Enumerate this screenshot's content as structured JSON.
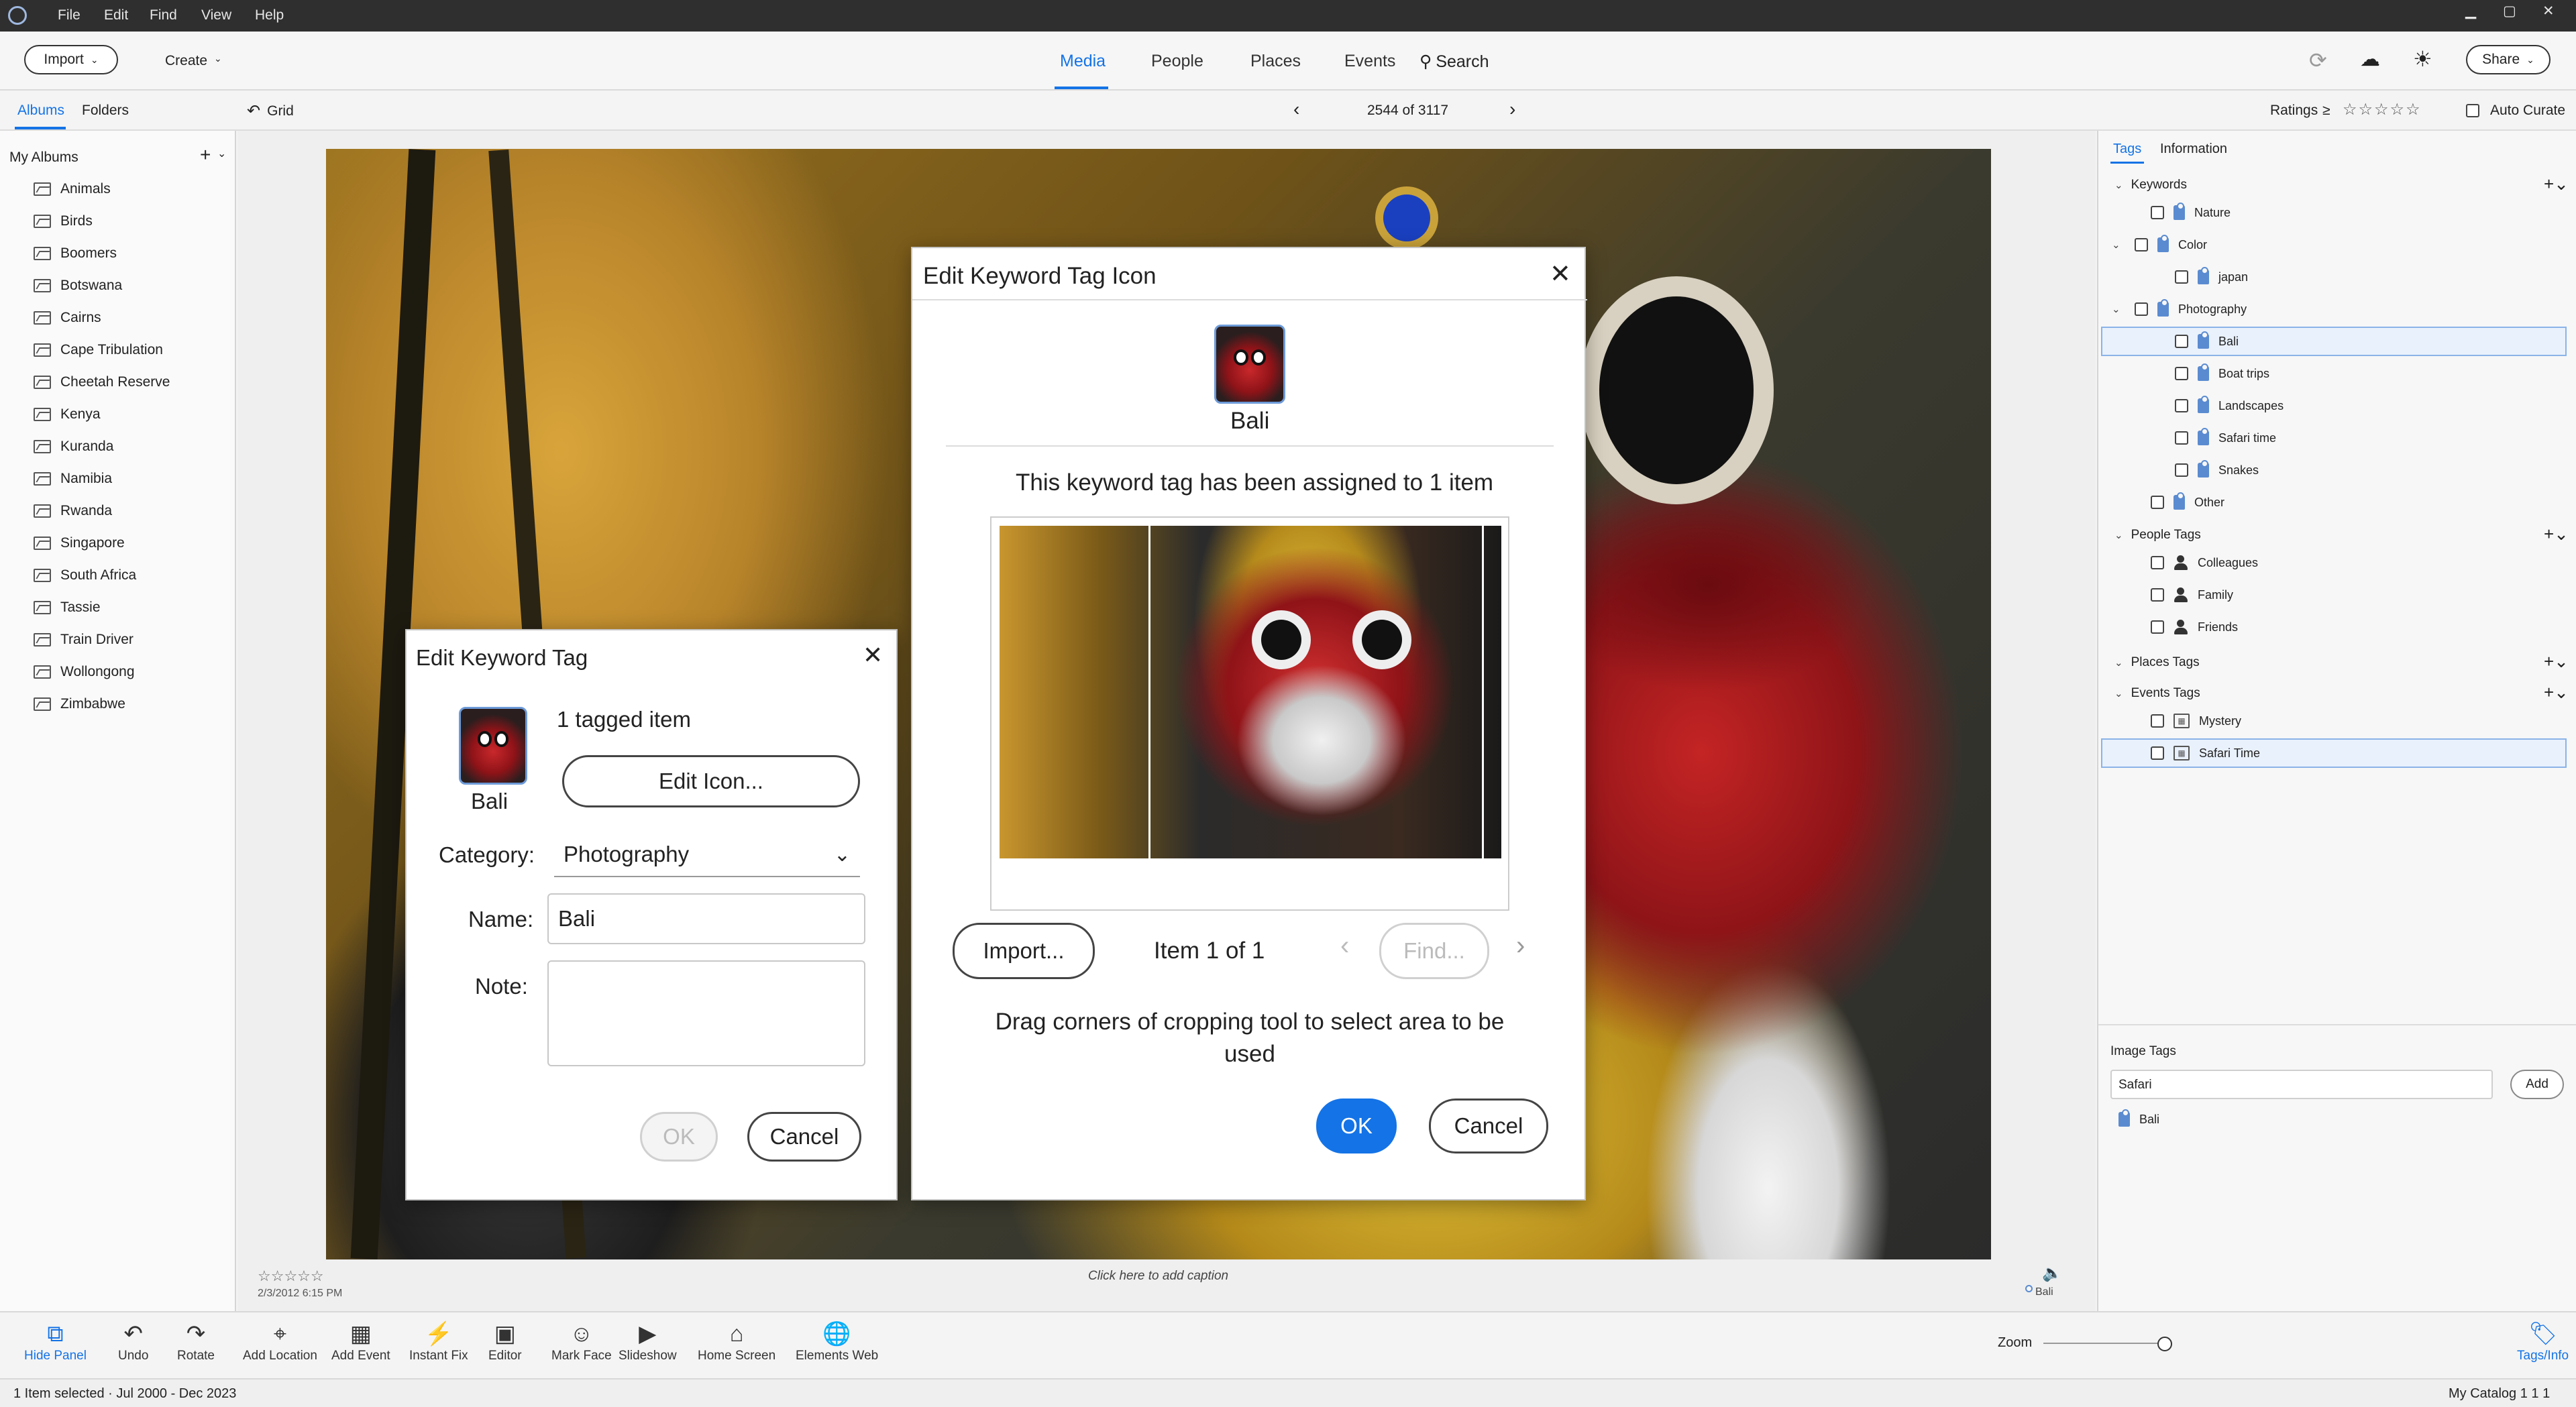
{
  "menu": {
    "items": [
      "File",
      "Edit",
      "Find",
      "View",
      "Help"
    ]
  },
  "header": {
    "import_label": "Import",
    "create_label": "Create",
    "tabs": [
      "Media",
      "People",
      "Places",
      "Events"
    ],
    "search_label": "Search",
    "share_label": "Share"
  },
  "subbar": {
    "albums_tab": "Albums",
    "folders_tab": "Folders",
    "grid_label": "Grid",
    "counter": "2544 of 3117",
    "ratings_label": "Ratings",
    "ratings_op": "≥",
    "auto_curate_label": "Auto Curate"
  },
  "albums": {
    "title": "My Albums",
    "items": [
      "Animals",
      "Birds",
      "Boomers",
      "Botswana",
      "Cairns",
      "Cape Tribulation",
      "Cheetah Reserve",
      "Kenya",
      "Kuranda",
      "Namibia",
      "Rwanda",
      "Singapore",
      "South Africa",
      "Tassie",
      "Train Driver",
      "Wollongong",
      "Zimbabwe"
    ]
  },
  "photo": {
    "stars": "☆☆☆☆☆",
    "date": "2/3/2012 6:15 PM",
    "caption_hint": "Click here to add caption",
    "tag_label": "Bali"
  },
  "right": {
    "tabs": [
      "Tags",
      "Information"
    ],
    "keywords_title": "Keywords",
    "keywords": [
      {
        "label": "Nature"
      },
      {
        "label": "Color"
      },
      {
        "label": "japan"
      },
      {
        "label": "Photography"
      },
      {
        "label": "Bali"
      },
      {
        "label": "Boat trips"
      },
      {
        "label": "Landscapes"
      },
      {
        "label": "Safari time"
      },
      {
        "label": "Snakes"
      },
      {
        "label": "Other"
      }
    ],
    "people_title": "People Tags",
    "people": [
      "Colleagues",
      "Family",
      "Friends"
    ],
    "places_title": "Places Tags",
    "events_title": "Events Tags",
    "events": [
      "Mystery",
      "Safari Time"
    ],
    "image_tags_title": "Image Tags",
    "image_tags_input": "Safari",
    "add_label": "Add",
    "image_tag_item": "Bali"
  },
  "toolbar": {
    "tools": [
      "Hide Panel",
      "Undo",
      "Rotate",
      "Add Location",
      "Add Event",
      "Instant Fix",
      "Editor",
      "Mark Face",
      "Slideshow",
      "Home Screen",
      "Elements Web"
    ],
    "zoom_label": "Zoom",
    "tags_info_label": "Tags/Info"
  },
  "status": {
    "left": "1 Item selected · Jul 2000 - Dec 2023",
    "right": "My Catalog 1 1 1"
  },
  "edit_tag": {
    "title": "Edit Keyword Tag",
    "tag_name": "Bali",
    "tagged_items": "1 tagged item",
    "edit_icon_label": "Edit Icon...",
    "category_label": "Category:",
    "category_value": "Photography",
    "name_label": "Name:",
    "name_value": "Bali",
    "note_label": "Note:",
    "ok_label": "OK",
    "cancel_label": "Cancel"
  },
  "edit_icon": {
    "title": "Edit Keyword Tag Icon",
    "tag_name": "Bali",
    "assigned_text": "This keyword tag has been assigned to 1 item",
    "import_label": "Import...",
    "item_counter": "Item 1 of 1",
    "find_label": "Find...",
    "instructions": "Drag corners of cropping tool to select area to be used",
    "ok_label": "OK",
    "cancel_label": "Cancel"
  },
  "colors": {
    "accent": "#1473e6",
    "tag_icon": "#5a8bd0"
  }
}
